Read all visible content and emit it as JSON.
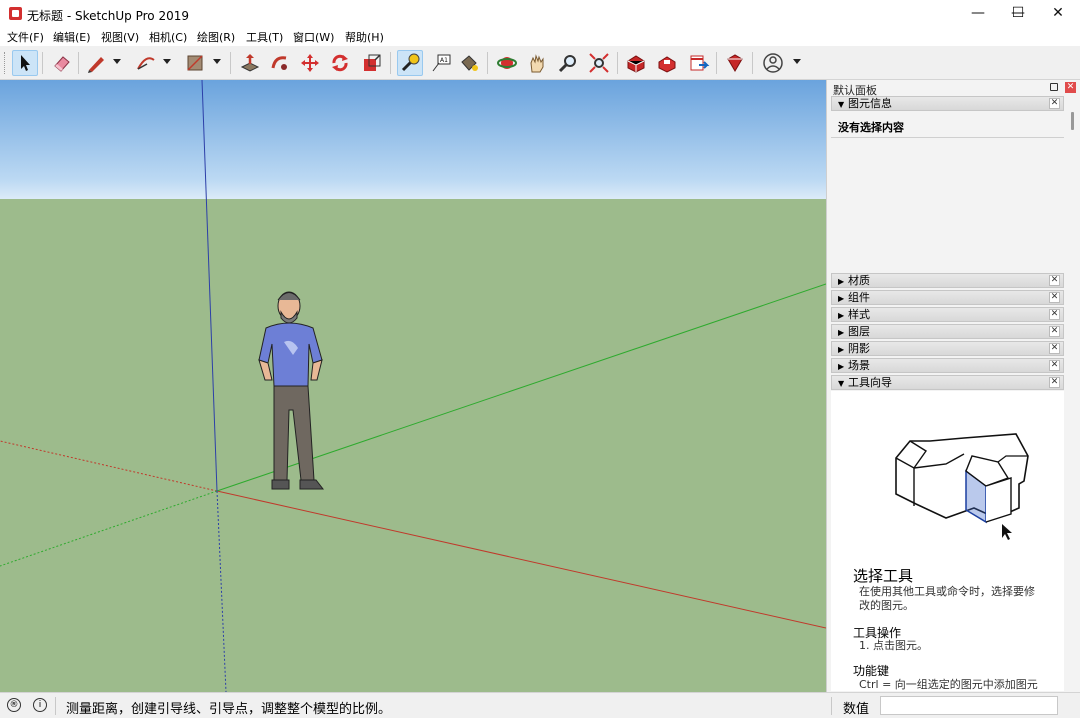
{
  "window": {
    "title": "无标题 - SketchUp Pro 2019",
    "minimize_label": "—",
    "maximize_label": "☐",
    "close_label": "✕"
  },
  "menu": [
    {
      "label": "文件(F)"
    },
    {
      "label": "编辑(E)"
    },
    {
      "label": "视图(V)"
    },
    {
      "label": "相机(C)"
    },
    {
      "label": "绘图(R)"
    },
    {
      "label": "工具(T)"
    },
    {
      "label": "窗口(W)"
    },
    {
      "label": "帮助(H)"
    }
  ],
  "toolbar": {
    "tools": [
      {
        "icon": "select-arrow-icon",
        "active": true
      },
      {
        "icon": "eraser-icon"
      },
      {
        "icon": "pencil-line-icon"
      },
      {
        "icon": "arc-icon"
      },
      {
        "icon": "rectangle-shape-icon"
      },
      {
        "icon": "push-pull-icon"
      },
      {
        "icon": "follow-me-icon"
      },
      {
        "icon": "move-icon"
      },
      {
        "icon": "rotate-icon"
      },
      {
        "icon": "scale-icon"
      },
      {
        "icon": "tape-measure-icon",
        "active": true
      },
      {
        "icon": "text-label-icon"
      },
      {
        "icon": "paint-bucket-icon"
      },
      {
        "icon": "orbit-icon"
      },
      {
        "icon": "pan-icon"
      },
      {
        "icon": "zoom-icon"
      },
      {
        "icon": "zoom-extents-icon"
      },
      {
        "icon": "3d-warehouse-icon"
      },
      {
        "icon": "extension-warehouse-icon"
      },
      {
        "icon": "send-to-layout-icon"
      },
      {
        "icon": "extension-manager-icon"
      },
      {
        "icon": "account-icon"
      }
    ]
  },
  "tray": {
    "title": "默认面板",
    "entity_info": {
      "label": "图元信息",
      "content": "没有选择内容"
    },
    "panels": [
      {
        "label": "材质",
        "expanded": false
      },
      {
        "label": "组件",
        "expanded": false
      },
      {
        "label": "样式",
        "expanded": false
      },
      {
        "label": "图层",
        "expanded": false
      },
      {
        "label": "阴影",
        "expanded": false
      },
      {
        "label": "场景",
        "expanded": false
      },
      {
        "label": "工具向导",
        "expanded": true
      }
    ],
    "instructor": {
      "title": "选择工具",
      "description_line1": "在使用其他工具或命令时，选择要修",
      "description_line2": "改的图元。",
      "operations_heading": "工具操作",
      "operation_1": "1. 点击图元。",
      "modifier_heading": "功能键",
      "modifier_1": "Ctrl = 向一组选定的图元中添加图元"
    }
  },
  "statusbar": {
    "hint": "测量距离，创建引导线、引导点，调整整个模型的比例。",
    "measurements_label": "数值",
    "measurements_value": ""
  },
  "colors": {
    "sky_top": "#6aa3dd",
    "ground": "#9dbb8c",
    "axis_red": "#c0392b",
    "axis_green": "#2eaa2e",
    "axis_blue": "#2c3fa8",
    "accent": "#cce4f7"
  }
}
